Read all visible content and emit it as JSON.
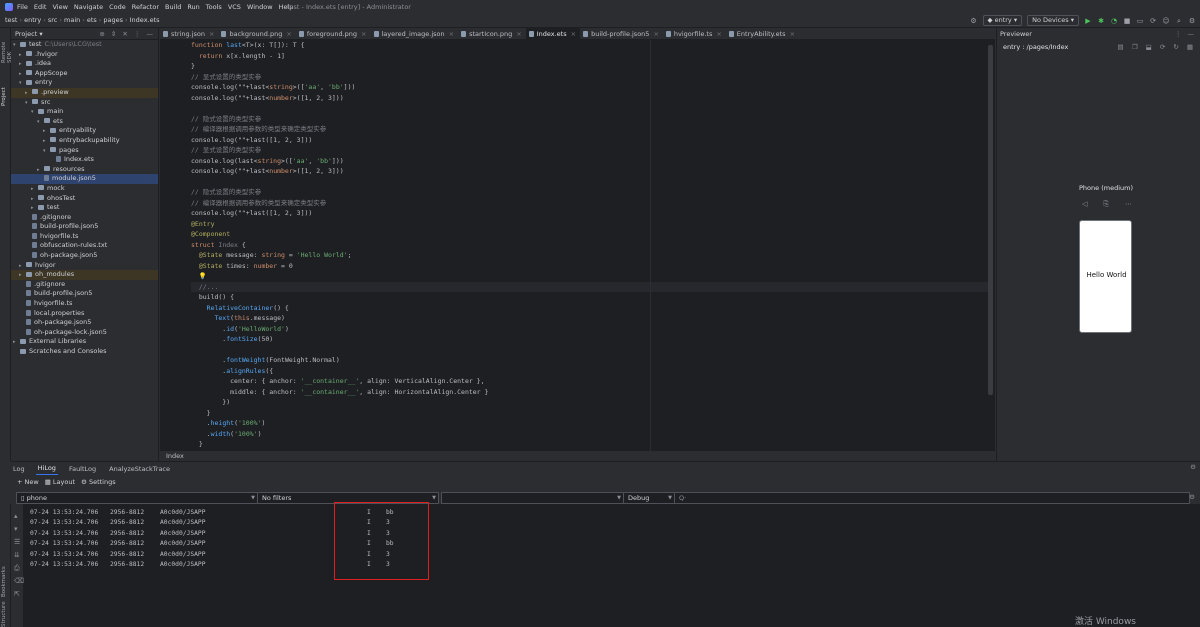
{
  "menu": {
    "items": [
      "File",
      "Edit",
      "View",
      "Navigate",
      "Code",
      "Refactor",
      "Build",
      "Run",
      "Tools",
      "VCS",
      "Window",
      "Help"
    ],
    "window_title": "test - Index.ets [entry] - Administrator"
  },
  "toolbar": {
    "breadcrumb": [
      "test",
      "entry",
      "src",
      "main",
      "ets",
      "pages",
      "Index.ets"
    ],
    "run_config": "entry",
    "device": "No Devices"
  },
  "left_strip": {
    "tabs": [
      "Project",
      "Remote SDK"
    ]
  },
  "project": {
    "title": "Project",
    "tree": [
      {
        "label": "test",
        "note": "C:\\Users\\LCG\\test",
        "indent": 0,
        "arrow": "▾",
        "type": "folder"
      },
      {
        "label": ".hvigor",
        "indent": 1,
        "arrow": "▸",
        "type": "folder"
      },
      {
        "label": ".idea",
        "indent": 1,
        "arrow": "▸",
        "type": "folder"
      },
      {
        "label": "AppScope",
        "indent": 1,
        "arrow": "▸",
        "type": "folder"
      },
      {
        "label": "entry",
        "indent": 1,
        "arrow": "▾",
        "type": "folder"
      },
      {
        "label": ".preview",
        "indent": 2,
        "arrow": "▸",
        "type": "folder",
        "state": "excluded"
      },
      {
        "label": "src",
        "indent": 2,
        "arrow": "▾",
        "type": "folder"
      },
      {
        "label": "main",
        "indent": 3,
        "arrow": "▾",
        "type": "folder"
      },
      {
        "label": "ets",
        "indent": 4,
        "arrow": "▾",
        "type": "folder"
      },
      {
        "label": "entryability",
        "indent": 5,
        "arrow": "▸",
        "type": "folder"
      },
      {
        "label": "entrybackupability",
        "indent": 5,
        "arrow": "▸",
        "type": "folder"
      },
      {
        "label": "pages",
        "indent": 5,
        "arrow": "▾",
        "type": "folder"
      },
      {
        "label": "Index.ets",
        "indent": 6,
        "arrow": "",
        "type": "file"
      },
      {
        "label": "resources",
        "indent": 4,
        "arrow": "▸",
        "type": "folder"
      },
      {
        "label": "module.json5",
        "indent": 4,
        "arrow": "",
        "type": "file",
        "state": "selected"
      },
      {
        "label": "mock",
        "indent": 3,
        "arrow": "▸",
        "type": "folder"
      },
      {
        "label": "ohosTest",
        "indent": 3,
        "arrow": "▸",
        "type": "folder"
      },
      {
        "label": "test",
        "indent": 3,
        "arrow": "▸",
        "type": "folder"
      },
      {
        "label": ".gitignore",
        "indent": 2,
        "arrow": "",
        "type": "file"
      },
      {
        "label": "build-profile.json5",
        "indent": 2,
        "arrow": "",
        "type": "file"
      },
      {
        "label": "hvigorfile.ts",
        "indent": 2,
        "arrow": "",
        "type": "file"
      },
      {
        "label": "obfuscation-rules.txt",
        "indent": 2,
        "arrow": "",
        "type": "file"
      },
      {
        "label": "oh-package.json5",
        "indent": 2,
        "arrow": "",
        "type": "file"
      },
      {
        "label": "hvigor",
        "indent": 1,
        "arrow": "▸",
        "type": "folder"
      },
      {
        "label": "oh_modules",
        "indent": 1,
        "arrow": "▸",
        "type": "folder",
        "state": "excluded"
      },
      {
        "label": ".gitignore",
        "indent": 1,
        "arrow": "",
        "type": "file"
      },
      {
        "label": "build-profile.json5",
        "indent": 1,
        "arrow": "",
        "type": "file"
      },
      {
        "label": "hvigorfile.ts",
        "indent": 1,
        "arrow": "",
        "type": "file"
      },
      {
        "label": "local.properties",
        "indent": 1,
        "arrow": "",
        "type": "file"
      },
      {
        "label": "oh-package.json5",
        "indent": 1,
        "arrow": "",
        "type": "file"
      },
      {
        "label": "oh-package-lock.json5",
        "indent": 1,
        "arrow": "",
        "type": "file"
      },
      {
        "label": "External Libraries",
        "indent": 0,
        "arrow": "▸",
        "type": "folder"
      },
      {
        "label": "Scratches and Consoles",
        "indent": 0,
        "arrow": "",
        "type": "folder"
      }
    ]
  },
  "tabs": [
    {
      "label": "string.json"
    },
    {
      "label": "background.png"
    },
    {
      "label": "foreground.png"
    },
    {
      "label": "layered_image.json"
    },
    {
      "label": "startIcon.png"
    },
    {
      "label": "Index.ets",
      "active": true
    },
    {
      "label": "build-profile.json5"
    },
    {
      "label": "hvigorfile.ts"
    },
    {
      "label": "EntryAbility.ets"
    }
  ],
  "editor": {
    "footer": "Index",
    "lines": [
      [
        {
          "t": "function ",
          "c": "kw"
        },
        {
          "t": "last",
          "c": "fn"
        },
        {
          "t": "<T>(x: T[]): T {"
        }
      ],
      [
        {
          "t": "  "
        },
        {
          "t": "return ",
          "c": "kw"
        },
        {
          "t": "x[x.length - 1]"
        }
      ],
      [
        {
          "t": "}"
        }
      ],
      [
        {
          "t": "// 显式设置的类型实参",
          "c": "cm"
        }
      ],
      [
        {
          "t": "console.log(\"\"+last<"
        },
        {
          "t": "string",
          "c": "kw"
        },
        {
          "t": ">(["
        },
        {
          "t": "'aa'",
          "c": "str"
        },
        {
          "t": ", "
        },
        {
          "t": "'bb'",
          "c": "str"
        },
        {
          "t": "]))"
        }
      ],
      [
        {
          "t": "console.log(\"\"+last<"
        },
        {
          "t": "number",
          "c": "kw"
        },
        {
          "t": ">([1, 2, 3]))"
        }
      ],
      [
        {
          "t": ""
        }
      ],
      [
        {
          "t": "// 隐式设置的类型实参",
          "c": "cm"
        }
      ],
      [
        {
          "t": "// 编译器根据调用参数的类型来确定类型实参",
          "c": "cm"
        }
      ],
      [
        {
          "t": "console.log(\"\"+last([1, 2, 3]))"
        }
      ],
      [
        {
          "t": "// 显式设置的类型实参",
          "c": "cm"
        }
      ],
      [
        {
          "t": "console.log(last<"
        },
        {
          "t": "string",
          "c": "kw"
        },
        {
          "t": ">(["
        },
        {
          "t": "'aa'",
          "c": "str"
        },
        {
          "t": ", "
        },
        {
          "t": "'bb'",
          "c": "str"
        },
        {
          "t": "]))"
        }
      ],
      [
        {
          "t": "console.log(\"\"+last<"
        },
        {
          "t": "number",
          "c": "kw"
        },
        {
          "t": ">([1, 2, 3]))"
        }
      ],
      [
        {
          "t": ""
        }
      ],
      [
        {
          "t": "// 隐式设置的类型实参",
          "c": "cm"
        }
      ],
      [
        {
          "t": "// 编译器根据调用参数的类型来确定类型实参",
          "c": "cm"
        }
      ],
      [
        {
          "t": "console.log(\"\"+last([1, 2, 3]))"
        }
      ],
      [
        {
          "t": "@Entry",
          "c": "ann"
        }
      ],
      [
        {
          "t": "@Component",
          "c": "ann"
        }
      ],
      [
        {
          "t": "struct ",
          "c": "kw"
        },
        {
          "t": "Index",
          "c": "cm"
        },
        {
          "t": " {"
        }
      ],
      [
        {
          "t": "  "
        },
        {
          "t": "@State",
          "c": "ann"
        },
        {
          "t": " message: "
        },
        {
          "t": "string",
          "c": "kw"
        },
        {
          "t": " = "
        },
        {
          "t": "'Hello World'",
          "c": "str"
        },
        {
          "t": ";"
        }
      ],
      [
        {
          "t": "  "
        },
        {
          "t": "@State",
          "c": "ann"
        },
        {
          "t": " times: "
        },
        {
          "t": "number",
          "c": "kw"
        },
        {
          "t": " = 0"
        }
      ],
      [
        {
          "t": "  💡"
        }
      ],
      [
        {
          "t": "  //...",
          "c": "cm"
        }
      ],
      [
        {
          "t": "  build() {"
        }
      ],
      [
        {
          "t": "    "
        },
        {
          "t": "RelativeContainer",
          "c": "fn"
        },
        {
          "t": "() {"
        }
      ],
      [
        {
          "t": "      "
        },
        {
          "t": "Text",
          "c": "fn"
        },
        {
          "t": "("
        },
        {
          "t": "this",
          "c": "kw"
        },
        {
          "t": ".message)"
        }
      ],
      [
        {
          "t": "        ."
        },
        {
          "t": "id",
          "c": "fn"
        },
        {
          "t": "("
        },
        {
          "t": "'HelloWorld'",
          "c": "str"
        },
        {
          "t": ")"
        }
      ],
      [
        {
          "t": "        ."
        },
        {
          "t": "fontSize",
          "c": "fn"
        },
        {
          "t": "(50)"
        }
      ],
      [
        {
          "t": ""
        }
      ],
      [
        {
          "t": "        ."
        },
        {
          "t": "fontWeight",
          "c": "fn"
        },
        {
          "t": "(FontWeight.Normal)"
        }
      ],
      [
        {
          "t": "        ."
        },
        {
          "t": "alignRules",
          "c": "fn"
        },
        {
          "t": "({"
        }
      ],
      [
        {
          "t": "          center: { anchor: "
        },
        {
          "t": "'__container__'",
          "c": "str"
        },
        {
          "t": ", align: VerticalAlign.Center },"
        }
      ],
      [
        {
          "t": "          middle: { anchor: "
        },
        {
          "t": "'__container__'",
          "c": "str"
        },
        {
          "t": ", align: HorizontalAlign.Center }"
        }
      ],
      [
        {
          "t": "        })"
        }
      ],
      [
        {
          "t": "    }"
        }
      ],
      [
        {
          "t": "    ."
        },
        {
          "t": "height",
          "c": "fn"
        },
        {
          "t": "("
        },
        {
          "t": "'100%'",
          "c": "str"
        },
        {
          "t": ")"
        }
      ],
      [
        {
          "t": "    ."
        },
        {
          "t": "width",
          "c": "fn"
        },
        {
          "t": "("
        },
        {
          "t": "'100%'",
          "c": "str"
        },
        {
          "t": ")"
        }
      ],
      [
        {
          "t": "  }"
        }
      ]
    ]
  },
  "previewer": {
    "title": "Previewer",
    "route": "entry : /pages/Index",
    "device_label": "Phone (medium)",
    "phone_text": "Hello World"
  },
  "log": {
    "tabs": [
      {
        "label": "Log"
      },
      {
        "label": "HiLog",
        "active": true
      },
      {
        "label": "FaultLog"
      },
      {
        "label": "AnalyzeStackTrace"
      }
    ],
    "actions": [
      "+ New",
      "Layout",
      "Settings"
    ],
    "device_filter": "phone",
    "filter": "No filters",
    "level": "Debug",
    "search_placeholder": "Q·",
    "rows": [
      {
        "time": "07-24 13:53:24.706",
        "pid": "2956-8812",
        "tag": "A0c0d0/JSAPP",
        "level": "I",
        "msg": "bb"
      },
      {
        "time": "07-24 13:53:24.706",
        "pid": "2956-8812",
        "tag": "A0c0d0/JSAPP",
        "level": "I",
        "msg": "3"
      },
      {
        "time": "07-24 13:53:24.706",
        "pid": "2956-8812",
        "tag": "A0c0d0/JSAPP",
        "level": "I",
        "msg": "3"
      },
      {
        "time": "07-24 13:53:24.706",
        "pid": "2956-8812",
        "tag": "A0c0d0/JSAPP",
        "level": "I",
        "msg": "bb"
      },
      {
        "time": "07-24 13:53:24.706",
        "pid": "2956-8812",
        "tag": "A0c0d0/JSAPP",
        "level": "I",
        "msg": "3"
      },
      {
        "time": "07-24 13:53:24.706",
        "pid": "2956-8812",
        "tag": "A0c0d0/JSAPP",
        "level": "I",
        "msg": "3"
      }
    ]
  },
  "bottom_strip": {
    "tabs": [
      "Bookmarks",
      "Structure"
    ]
  },
  "watermark": "激活 Windows",
  "colors": {
    "accent": "#3574f0",
    "highlight": "#e02020",
    "editor_bg": "#1e1f22",
    "panel_bg": "#2b2d30"
  }
}
